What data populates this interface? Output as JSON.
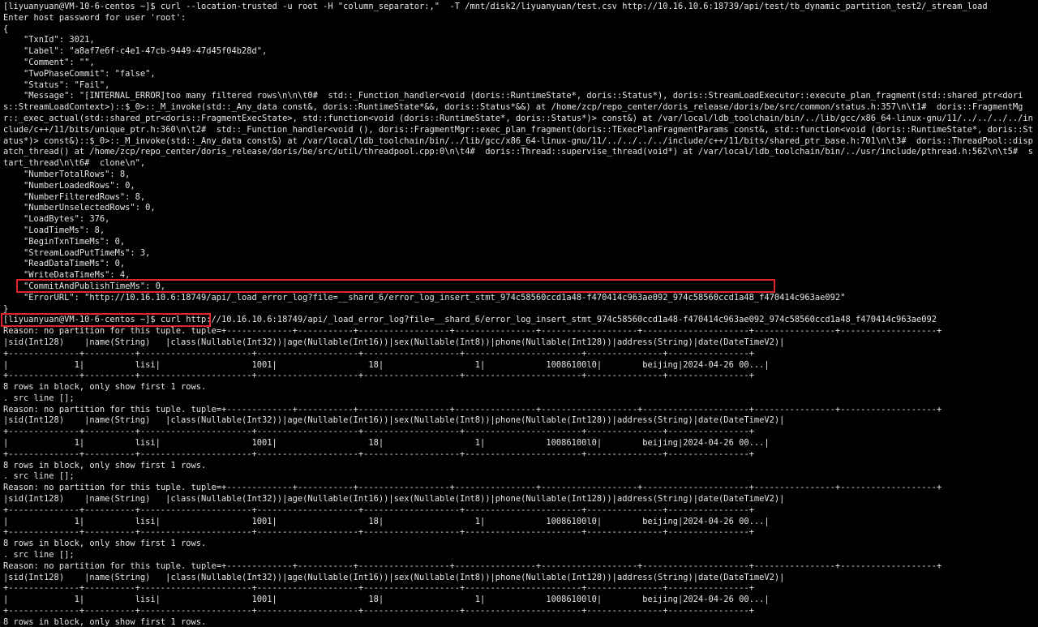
{
  "terminal": {
    "lines": [
      "[liyuanyuan@VM-10-6-centos ~]$ curl --location-trusted -u root -H \"column_separator:,\"  -T /mnt/disk2/liyuanyuan/test.csv http://10.16.10.6:18739/api/test/tb_dynamic_partition_test2/_stream_load",
      "Enter host password for user 'root':",
      "{",
      "    \"TxnId\": 3021,",
      "    \"Label\": \"a8af7e6f-c4e1-47cb-9449-47d45f04b28d\",",
      "    \"Comment\": \"\",",
      "    \"TwoPhaseCommit\": \"false\",",
      "    \"Status\": \"Fail\",",
      "    \"Message\": \"[INTERNAL_ERROR]too many filtered rows\\n\\n\\t0#  std::_Function_handler<void (doris::RuntimeState*, doris::Status*), doris::StreamLoadExecutor::execute_plan_fragment(std::shared_ptr<doris::StreamLoadContext>)::$_0>::_M_invoke(std::_Any_data const&, doris::RuntimeState*&&, doris::Status*&&) at /home/zcp/repo_center/doris_release/doris/be/src/common/status.h:357\\n\\t1#  doris::FragmentMgr::_exec_actual(std::shared_ptr<doris::FragmentExecState>, std::function<void (doris::RuntimeState*, doris::Status*)> const&) at /var/local/ldb_toolchain/bin/../lib/gcc/x86_64-linux-gnu/11/../../../../include/c++/11/bits/unique_ptr.h:360\\n\\t2#  std::_Function_handler<void (), doris::FragmentMgr::exec_plan_fragment(doris::TExecPlanFragmentParams const&, std::function<void (doris::RuntimeState*, doris::Status*)> const&)::$_0>::_M_invoke(std::_Any_data const&) at /var/local/ldb_toolchain/bin/../lib/gcc/x86_64-linux-gnu/11/../../../../include/c++/11/bits/shared_ptr_base.h:701\\n\\t3#  doris::ThreadPool::dispatch_thread() at /home/zcp/repo_center/doris_release/doris/be/src/util/threadpool.cpp:0\\n\\t4#  doris::Thread::supervise_thread(void*) at /var/local/ldb_toolchain/bin/../usr/include/pthread.h:562\\n\\t5#  start_thread\\n\\t6#  clone\\n\",",
      "    \"NumberTotalRows\": 8,",
      "    \"NumberLoadedRows\": 0,",
      "    \"NumberFilteredRows\": 8,",
      "    \"NumberUnselectedRows\": 0,",
      "    \"LoadBytes\": 376,",
      "    \"LoadTimeMs\": 8,",
      "    \"BeginTxnTimeMs\": 0,",
      "    \"StreamLoadPutTimeMs\": 3,",
      "    \"ReadDataTimeMs\": 0,",
      "    \"WriteDataTimeMs\": 4,",
      "    \"CommitAndPublishTimeMs\": 0,",
      "    \"ErrorURL\": \"http://10.16.10.6:18749/api/_load_error_log?file=__shard_6/error_log_insert_stmt_974c58560ccd1a48-f470414c963ae092_974c58560ccd1a48_f470414c963ae092\"",
      "}",
      "[liyuanyuan@VM-10-6-centos ~]$ curl http://10.16.10.6:18749/api/_load_error_log?file=__shard_6/error_log_insert_stmt_974c58560ccd1a48-f470414c963ae092_974c58560ccd1a48_f470414c963ae092",
      "Reason: no partition for this tuple. tuple=+-------------+-----------+------------------+----------------+-------------------+---------------------+----------------+-------------------+",
      "|sid(Int128)    |name(String)   |class(Nullable(Int32))|age(Nullable(Int16))|sex(Nullable(Int8))|phone(Nullable(Int128))|address(String)|date(DateTimeV2)|",
      "+--------------+----------+----------------------+--------------------+-------------------+-----------------------+---------------+----------------+",
      "|             1|          lisi|                  1001|                  18|                  1|            10086100l0|        beijing|2024-04-26 00...|",
      "+--------------+----------+----------------------+--------------------+-------------------+-----------------------+---------------+----------------+",
      "8 rows in block, only show first 1 rows.",
      ". src line [];",
      "Reason: no partition for this tuple. tuple=+-------------+-----------+------------------+----------------+-------------------+---------------------+----------------+-------------------+",
      "|sid(Int128)    |name(String)   |class(Nullable(Int32))|age(Nullable(Int16))|sex(Nullable(Int8))|phone(Nullable(Int128))|address(String)|date(DateTimeV2)|",
      "+--------------+----------+----------------------+--------------------+-------------------+-----------------------+---------------+----------------+",
      "|             1|          lisi|                  1001|                  18|                  1|            10086100l0|        beijing|2024-04-26 00...|",
      "+--------------+----------+----------------------+--------------------+-------------------+-----------------------+---------------+----------------+",
      "8 rows in block, only show first 1 rows.",
      ". src line [];",
      "Reason: no partition for this tuple. tuple=+-------------+-----------+------------------+----------------+-------------------+---------------------+----------------+-------------------+",
      "|sid(Int128)    |name(String)   |class(Nullable(Int32))|age(Nullable(Int16))|sex(Nullable(Int8))|phone(Nullable(Int128))|address(String)|date(DateTimeV2)|",
      "+--------------+----------+----------------------+--------------------+-------------------+-----------------------+---------------+----------------+",
      "|             1|          lisi|                  1001|                  18|                  1|            10086100l0|        beijing|2024-04-26 00...|",
      "+--------------+----------+----------------------+--------------------+-------------------+-----------------------+---------------+----------------+",
      "8 rows in block, only show first 1 rows.",
      ". src line [];",
      "Reason: no partition for this tuple. tuple=+-------------+-----------+------------------+----------------+-------------------+---------------------+----------------+-------------------+",
      "|sid(Int128)    |name(String)   |class(Nullable(Int32))|age(Nullable(Int16))|sex(Nullable(Int8))|phone(Nullable(Int128))|address(String)|date(DateTimeV2)|",
      "+--------------+----------+----------------------+--------------------+-------------------+-----------------------+---------------+----------------+",
      "|             1|          lisi|                  1001|                  18|                  1|            10086100l0|        beijing|2024-04-26 00...|",
      "+--------------+----------+----------------------+--------------------+-------------------+-----------------------+---------------+----------------+",
      "8 rows in block, only show first 1 rows.",
      ". src line [];"
    ]
  },
  "colors": {
    "background": "#000000",
    "text": "#e6e6e6",
    "highlight": "#e0262a"
  }
}
